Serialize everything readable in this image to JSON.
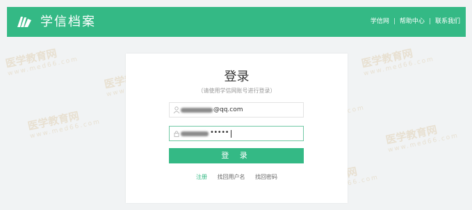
{
  "header": {
    "brand": "学信档案",
    "nav": [
      "学信网",
      "帮助中心",
      "联系我们"
    ],
    "separator": "|",
    "bg_color": "#34b985"
  },
  "login": {
    "title": "登录",
    "subtitle": "（请使用学信网账号进行登录）",
    "username_suffix": "@qq.com",
    "password_masked": "•••••",
    "button_label": "登 录",
    "links": {
      "register": "注册",
      "find_username": "找回用户名",
      "find_password": "找回密码"
    }
  },
  "watermark": {
    "text": "医学教育网",
    "site": "www.med66.com"
  },
  "icons": {
    "logo": "book-logo-icon",
    "user": "user-icon",
    "password": "lock-icon"
  }
}
